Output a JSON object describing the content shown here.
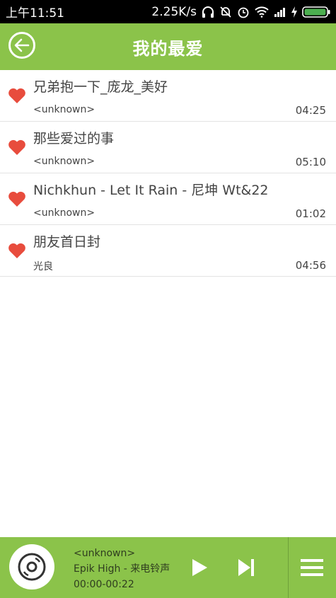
{
  "status_bar": {
    "time": "上午11:51",
    "speed": "2.25K/s"
  },
  "header": {
    "title": "我的最爱"
  },
  "songs": [
    {
      "title": "兄弟抱一下_庞龙_美好",
      "artist": "<unknown>",
      "duration": "04:25"
    },
    {
      "title": "那些爱过的事",
      "artist": "<unknown>",
      "duration": "05:10"
    },
    {
      "title": "Nichkhun - Let It Rain - 尼坤 Wt&22",
      "artist": "<unknown>",
      "duration": "01:02"
    },
    {
      "title": "朋友首日封",
      "artist": "光良",
      "duration": "04:56"
    }
  ],
  "player": {
    "artist": "<unknown>",
    "title": "Epik High - 来电铃声",
    "progress": "00:00-00:22"
  },
  "colors": {
    "accent": "#8bc34a",
    "heart": "#e84c3d"
  }
}
